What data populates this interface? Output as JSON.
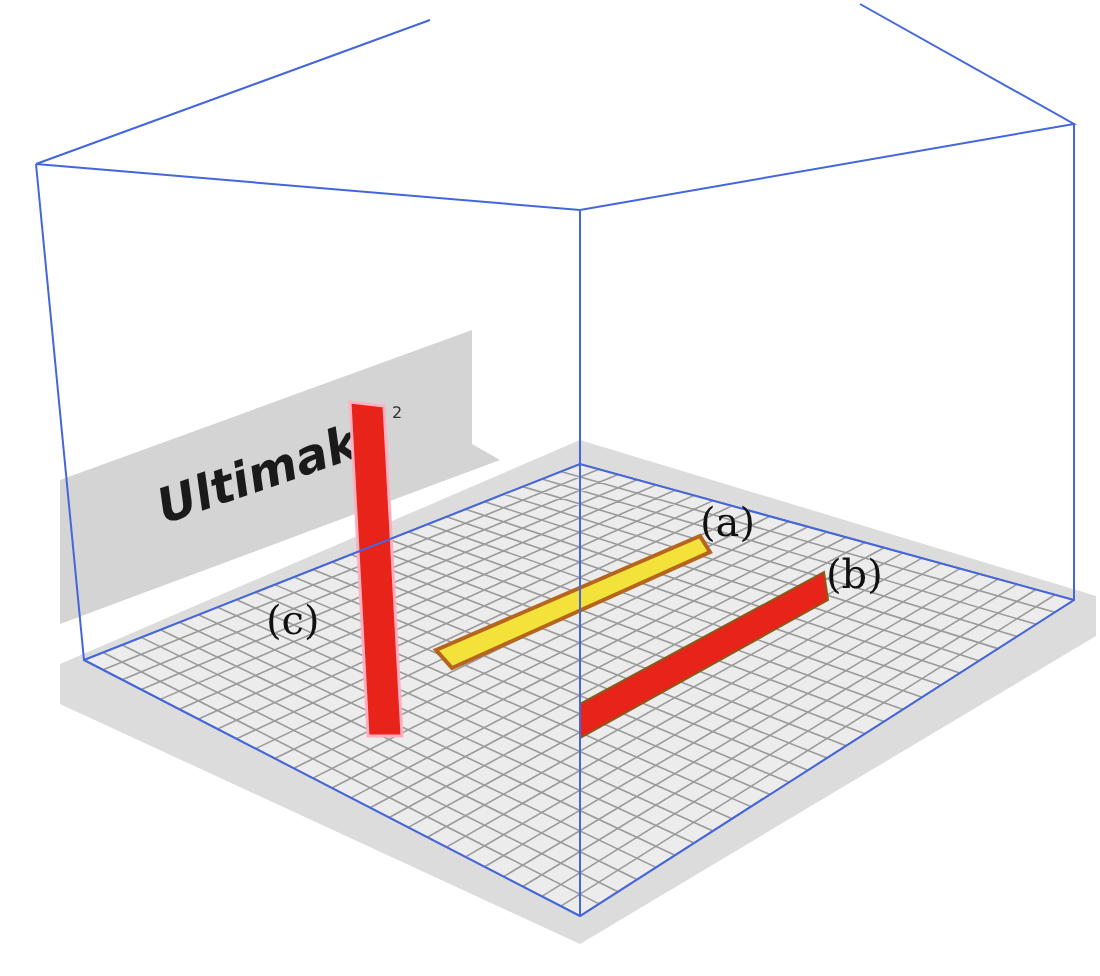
{
  "viewport": {
    "backplate_logo": "Ultimak",
    "backplate_mark": "2",
    "part_labels": [
      {
        "text": "(a)"
      },
      {
        "text": "(b)"
      },
      {
        "text": "(c)"
      }
    ]
  }
}
